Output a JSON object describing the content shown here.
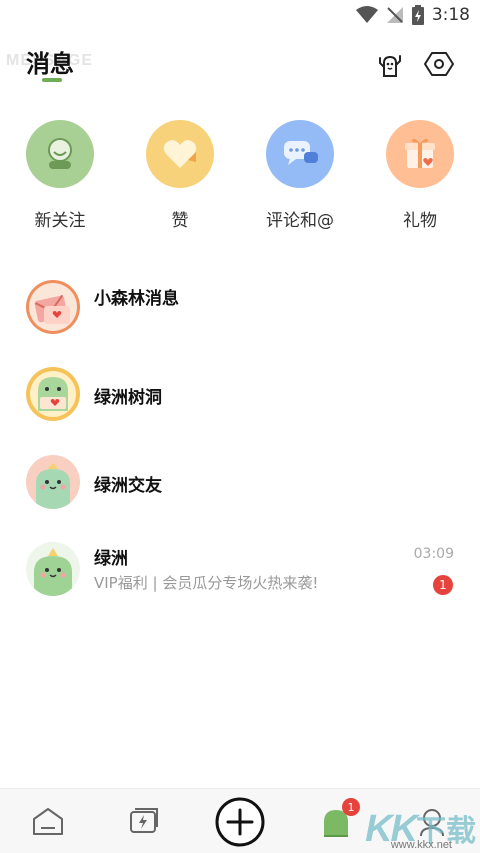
{
  "status_bar": {
    "time": "3:18"
  },
  "header": {
    "watermark": "MESSAGE",
    "title": "消息",
    "accent_color": "#6fae56"
  },
  "categories": [
    {
      "label": "新关注",
      "icon": "new-follower-icon",
      "color": "#9fc98a"
    },
    {
      "label": "赞",
      "icon": "heart-like-icon",
      "color": "#f7cf6a"
    },
    {
      "label": "评论和@",
      "icon": "comment-bubble-icon",
      "color": "#8fb6f5"
    },
    {
      "label": "礼物",
      "icon": "gift-box-icon",
      "color": "#ffb98c"
    }
  ],
  "messages": [
    {
      "name": "小森林消息",
      "preview": "",
      "time": "",
      "badge": ""
    },
    {
      "name": "绿洲树洞",
      "preview": "",
      "time": "",
      "badge": ""
    },
    {
      "name": "绿洲交友",
      "preview": "",
      "time": "",
      "badge": ""
    },
    {
      "name": "绿洲",
      "preview": "VIP福利 | 会员瓜分专场火热来袭!",
      "time": "03:09",
      "badge": "1"
    }
  ],
  "bottom_nav": {
    "items": [
      {
        "icon": "home-icon"
      },
      {
        "icon": "flash-message-icon"
      },
      {
        "icon": "add-icon"
      },
      {
        "icon": "cactus-message-icon",
        "badge": "1"
      },
      {
        "icon": "profile-icon"
      }
    ]
  },
  "watermark": {
    "brand": "KK",
    "suffix": "下载",
    "url": "www.kkx.net"
  }
}
